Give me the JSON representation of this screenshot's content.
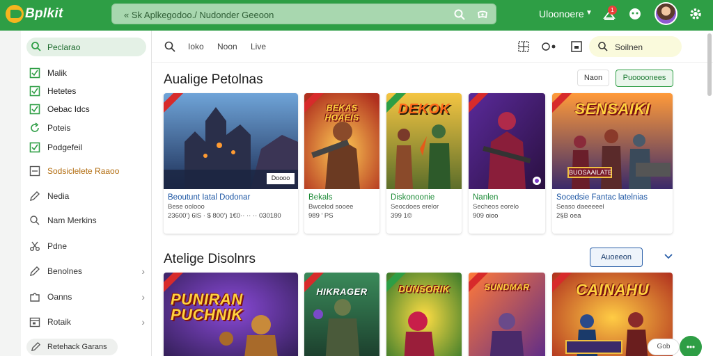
{
  "topbar": {
    "logo_text": "Bplkit",
    "search_text": "« Sk Aplkegodoo./ Nudonder  Geeoon",
    "account_label": "Uloonoere",
    "notif_count": "1",
    "colors": {
      "bar": "#2e9e45",
      "logo_accent": "#f5b51f"
    }
  },
  "sidebar": {
    "active_label": "Peclarao",
    "items": [
      {
        "label": "Malik",
        "icon": "check-box-icon"
      },
      {
        "label": "Hetetes",
        "icon": "check-box-icon"
      },
      {
        "label": "Oebac Idcs",
        "icon": "check-box-icon"
      },
      {
        "label": "Poteis",
        "icon": "refresh-icon"
      },
      {
        "label": "Podgefeil",
        "icon": "check-box-icon"
      },
      {
        "label": "Sodsiclelete Raaoo",
        "icon": "list-box-icon"
      },
      {
        "label": "Nedia",
        "icon": "pencil-icon"
      },
      {
        "label": "Nam Merkins",
        "icon": "search-icon"
      },
      {
        "label": "Pdne",
        "icon": "scissor-icon"
      },
      {
        "label": "Benolnes",
        "icon": "pencil-icon"
      },
      {
        "label": "Oanns",
        "icon": "puzzle-icon"
      },
      {
        "label": "Rotaik",
        "icon": "calendar-icon"
      }
    ],
    "footer_label": "Retehack Garans"
  },
  "toolbar": {
    "tabs": [
      "Ioko",
      "Noon",
      "Live"
    ],
    "pill_label": "Soilnen"
  },
  "section1": {
    "title": "Aualige Petolnas",
    "btn_plain": "Naon",
    "btn_green": "Puoooonees"
  },
  "section2": {
    "title": "Atelige Disolnrs",
    "btn_outline": "Auoeeon"
  },
  "cards_row1": [
    {
      "art_text": "",
      "title": "Beoutunt Iatal Dodonar",
      "sub": "Bese oolooo",
      "meta": "23600’) 6lS · $ 800’) 1€0·· ·· ·· 030180",
      "ribbon": "red",
      "badge": "Doooo"
    },
    {
      "art_text": "BEKAS HOAEIS",
      "title": "Bekals",
      "sub": "Bwcelod sooee",
      "meta": "989 ’ PS",
      "ribbon": "red",
      "badge": ""
    },
    {
      "art_text": "DEKOK",
      "title": "Diskonoonie",
      "sub": "Seocdoes erelor",
      "meta": "399 1©",
      "ribbon": "green",
      "badge": ""
    },
    {
      "art_text": "",
      "title": "Nanlen",
      "sub": "Secheos eorelo",
      "meta": "909 oioo",
      "ribbon": "red",
      "badge": ""
    },
    {
      "art_text": "SENSAIKI",
      "title": "Socedsie Fantac latelnias",
      "sub": "Seaso daeeeeel",
      "meta": "2§B oea",
      "ribbon": "red",
      "badge": "BUOSAAILATE"
    }
  ],
  "cards_row2": [
    {
      "art_text": "PUNIRAN PUCHNIK",
      "ribbon": "red"
    },
    {
      "art_text": "HIKRAGER",
      "ribbon": "red"
    },
    {
      "art_text": "DUNSORIK",
      "ribbon": "green"
    },
    {
      "art_text": "SUNDMAR",
      "ribbon": "red"
    },
    {
      "art_text": "CAINAHU",
      "ribbon": "red"
    }
  ],
  "footer_chip": "Gob"
}
